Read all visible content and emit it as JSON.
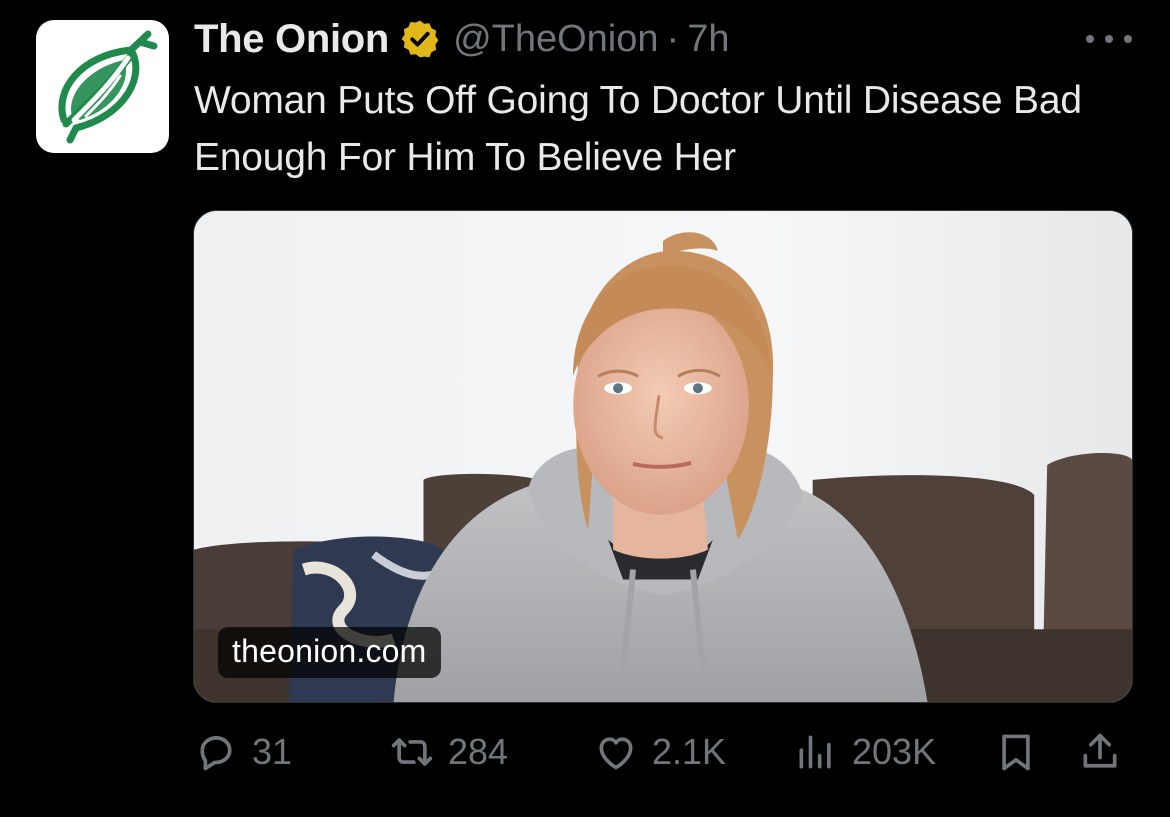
{
  "account": {
    "display_name": "The Onion",
    "handle": "@TheOnion",
    "separator": "·",
    "time": "7h",
    "verified_icon": "verified-badge-gold-icon",
    "avatar_icon": "onion-logo-icon"
  },
  "tweet": {
    "text": "Woman Puts Off Going To Doctor Until Disease Bad Enough For Him To Believe Her"
  },
  "media": {
    "domain_label": "theonion.com",
    "image_name": "woman-on-couch-photo"
  },
  "actions": {
    "reply": {
      "icon": "reply-bubble-icon",
      "count": "31"
    },
    "retweet": {
      "icon": "retweet-icon",
      "count": "284"
    },
    "like": {
      "icon": "heart-icon",
      "count": "2.1K"
    },
    "views": {
      "icon": "views-chart-icon",
      "count": "203K"
    },
    "bookmark": {
      "icon": "bookmark-icon"
    },
    "share": {
      "icon": "share-icon"
    }
  },
  "colors": {
    "background": "#000000",
    "primary_text": "#e7e9ea",
    "secondary_text": "#71767b",
    "verified_gold": "#e2b719",
    "onion_green": "#1f8a4c"
  }
}
